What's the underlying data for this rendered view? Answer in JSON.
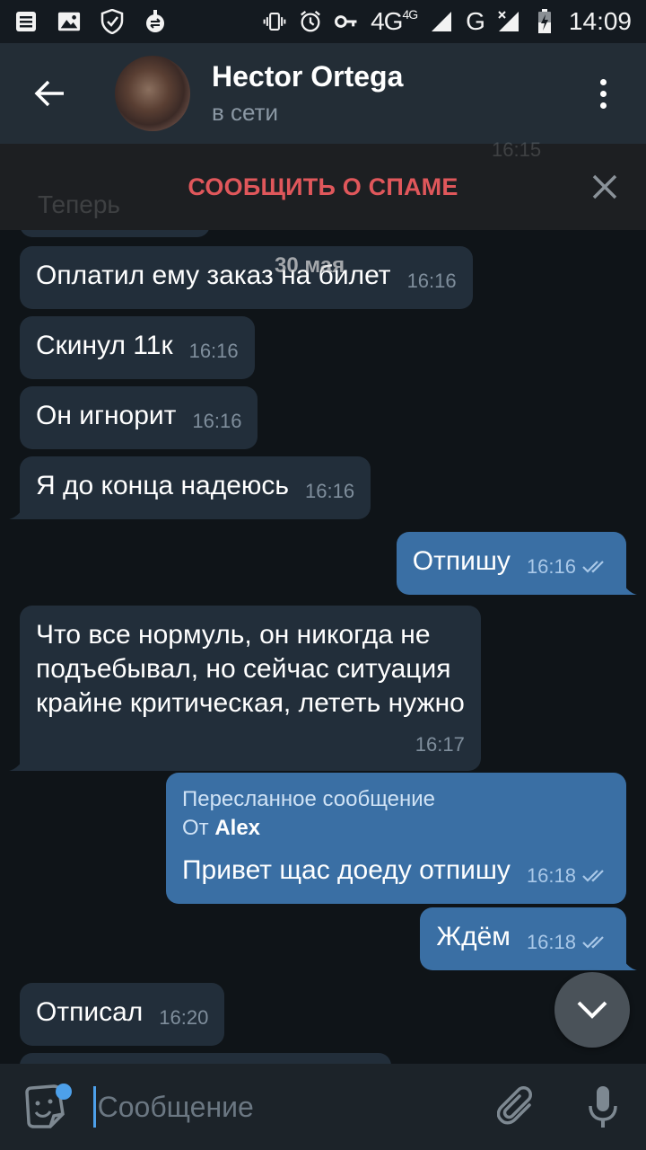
{
  "status_bar": {
    "network_1": "4G",
    "network_1_sup": "4G",
    "network_2": "G",
    "time": "14:09"
  },
  "header": {
    "title": "Hector Ortega",
    "status": "в сети"
  },
  "spam_bar": {
    "label": "СООБЩИТЬ О СПАМЕ"
  },
  "chat": {
    "date": "30 мая",
    "messages": [
      {
        "text": "Оплатил ему заказ на билет",
        "time": "16:16"
      },
      {
        "text": "Скинул 11к",
        "time": "16:16"
      },
      {
        "text": "Он игнорит",
        "time": "16:16"
      },
      {
        "text": "Я до конца надеюсь",
        "time": "16:16"
      },
      {
        "text": "Отпишу",
        "time": "16:16"
      },
      {
        "lines": [
          "Что все нормуль, он никогда не",
          "подъебывал, но сейчас ситуация",
          "крайне критическая, лететь нужно"
        ],
        "time": "16:17"
      },
      {
        "forward_label": "Пересланное сообщение",
        "forward_from_prefix": "От",
        "forward_from": "Alex",
        "text": "Привет щас доеду отпишу",
        "time": "16:18"
      },
      {
        "text": "Ждём",
        "time": "16:18"
      },
      {
        "text": "Отписал",
        "time": "16:20"
      }
    ],
    "ghost_text": [
      "Теперь",
      "16:15"
    ]
  },
  "composer": {
    "placeholder": "Сообщение"
  },
  "colors": {
    "header_bg": "#232d36",
    "incoming_bubble": "#222e3a",
    "outgoing_bubble": "#3a6fa4",
    "spam_text": "#e0575b",
    "accent": "#4da0ea"
  }
}
